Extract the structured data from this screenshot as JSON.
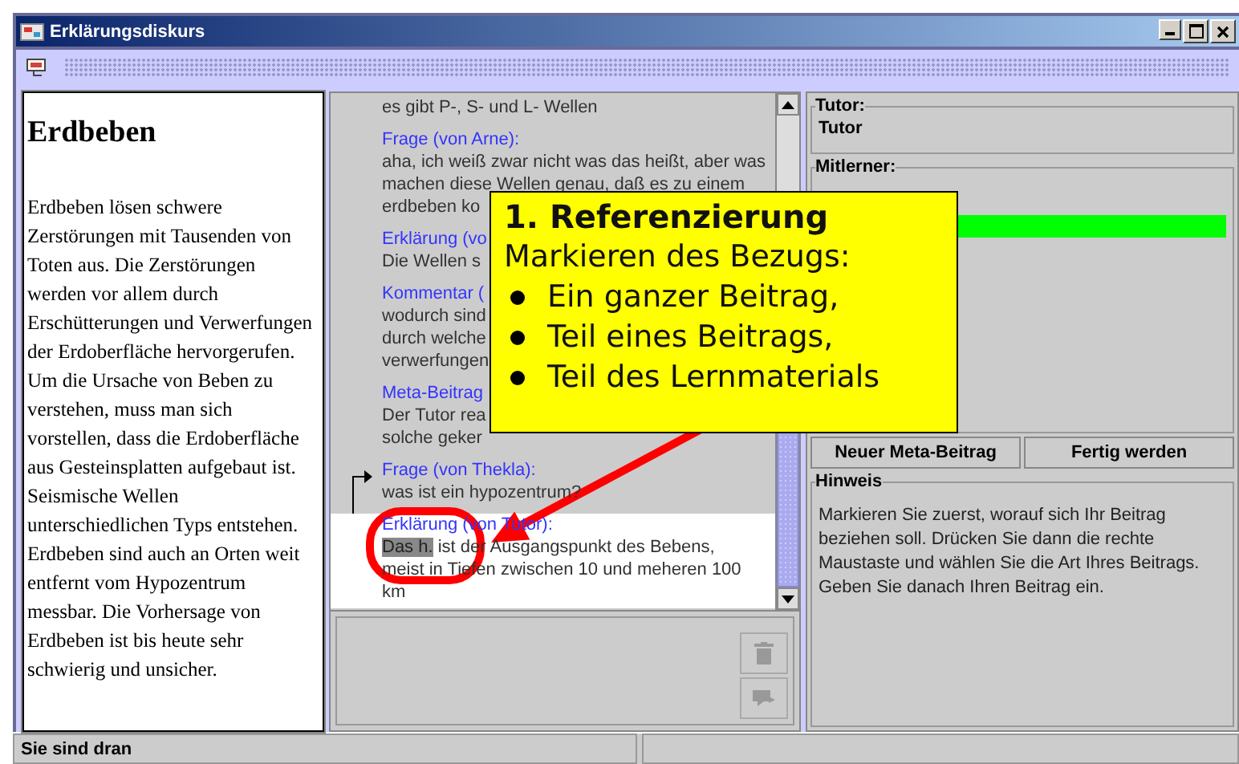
{
  "window": {
    "title": "Erklärungsdiskurs"
  },
  "material": {
    "heading": "Erdbeben",
    "text": "Erdbeben lösen schwere Zerstörungen mit Tausenden von Toten aus. Die Zerstörungen werden vor allem durch Erschütterungen und Verwerfungen der Erdoberfläche hervorgerufen. Um die Ursache von Beben zu verstehen, muss man sich vorstellen, dass die Erdoberfläche aus Gesteinsplatten aufgebaut ist. Seismische Wellen unterschiedlichen Typs entstehen. Erdbeben sind auch an Orten weit entfernt vom Hypozentrum messbar. Die Vorhersage von Erdbeben ist bis heute sehr schwierig und unsicher."
  },
  "messages": [
    {
      "lines": [
        "es gibt P-, S- und L- Wellen"
      ],
      "selected": false,
      "reply_link": false
    },
    {
      "header": "Frage (von Arne):",
      "lines": [
        "aha, ich weiß zwar nicht was das heißt, aber was",
        "machen diese Wellen genau, daß es zu einem",
        "erdbeben ko"
      ],
      "selected": false,
      "reply_link": false
    },
    {
      "header": "Erklärung (vo",
      "lines": [
        "Die Wellen s"
      ],
      "selected": false,
      "reply_link": false
    },
    {
      "header": "Kommentar (",
      "lines": [
        "wodurch sind",
        "durch welche",
        "verwerfungen"
      ],
      "selected": false,
      "reply_link": false
    },
    {
      "header": "Meta-Beitrag",
      "lines": [
        "Der Tutor rea",
        "solche geker"
      ],
      "selected": false,
      "reply_link": false
    },
    {
      "header": "Frage (von Thekla):",
      "lines": [
        "was ist ein hypozentrum?"
      ],
      "selected": false,
      "reply_link": true
    },
    {
      "header": "Erklärung (von Tutor):",
      "marked_text": "Das h.",
      "lines": [
        " ist der Ausgangspunkt des Bebens,",
        "meist in Tiefen zwischen 10 und meheren 100",
        "km"
      ],
      "selected": true,
      "reply_link": false
    }
  ],
  "tutor": {
    "legend": "Tutor:",
    "name": "Tutor"
  },
  "mitlerner": {
    "legend": "Mitlerner:",
    "participants": [
      {
        "active": true
      }
    ]
  },
  "buttons": [
    "Neuer Meta-Beitrag",
    "Fertig werden"
  ],
  "hinweis": {
    "legend": "Hinweis",
    "text": "Markieren Sie zuerst, worauf sich Ihr Beitrag beziehen soll. Drücken Sie dann die rechte Maustaste und wählen Sie die Art Ihres Beitrags. Geben Sie danach Ihren Beitrag ein."
  },
  "status_bar": {
    "text": "Sie sind dran"
  },
  "callout": {
    "title": "1. Referenzierung",
    "subtitle": "Markieren des Bezugs:",
    "bullets": [
      "Ein ganzer Beitrag,",
      "Teil eines Beitrags,",
      "Teil des Lernmaterials"
    ]
  }
}
